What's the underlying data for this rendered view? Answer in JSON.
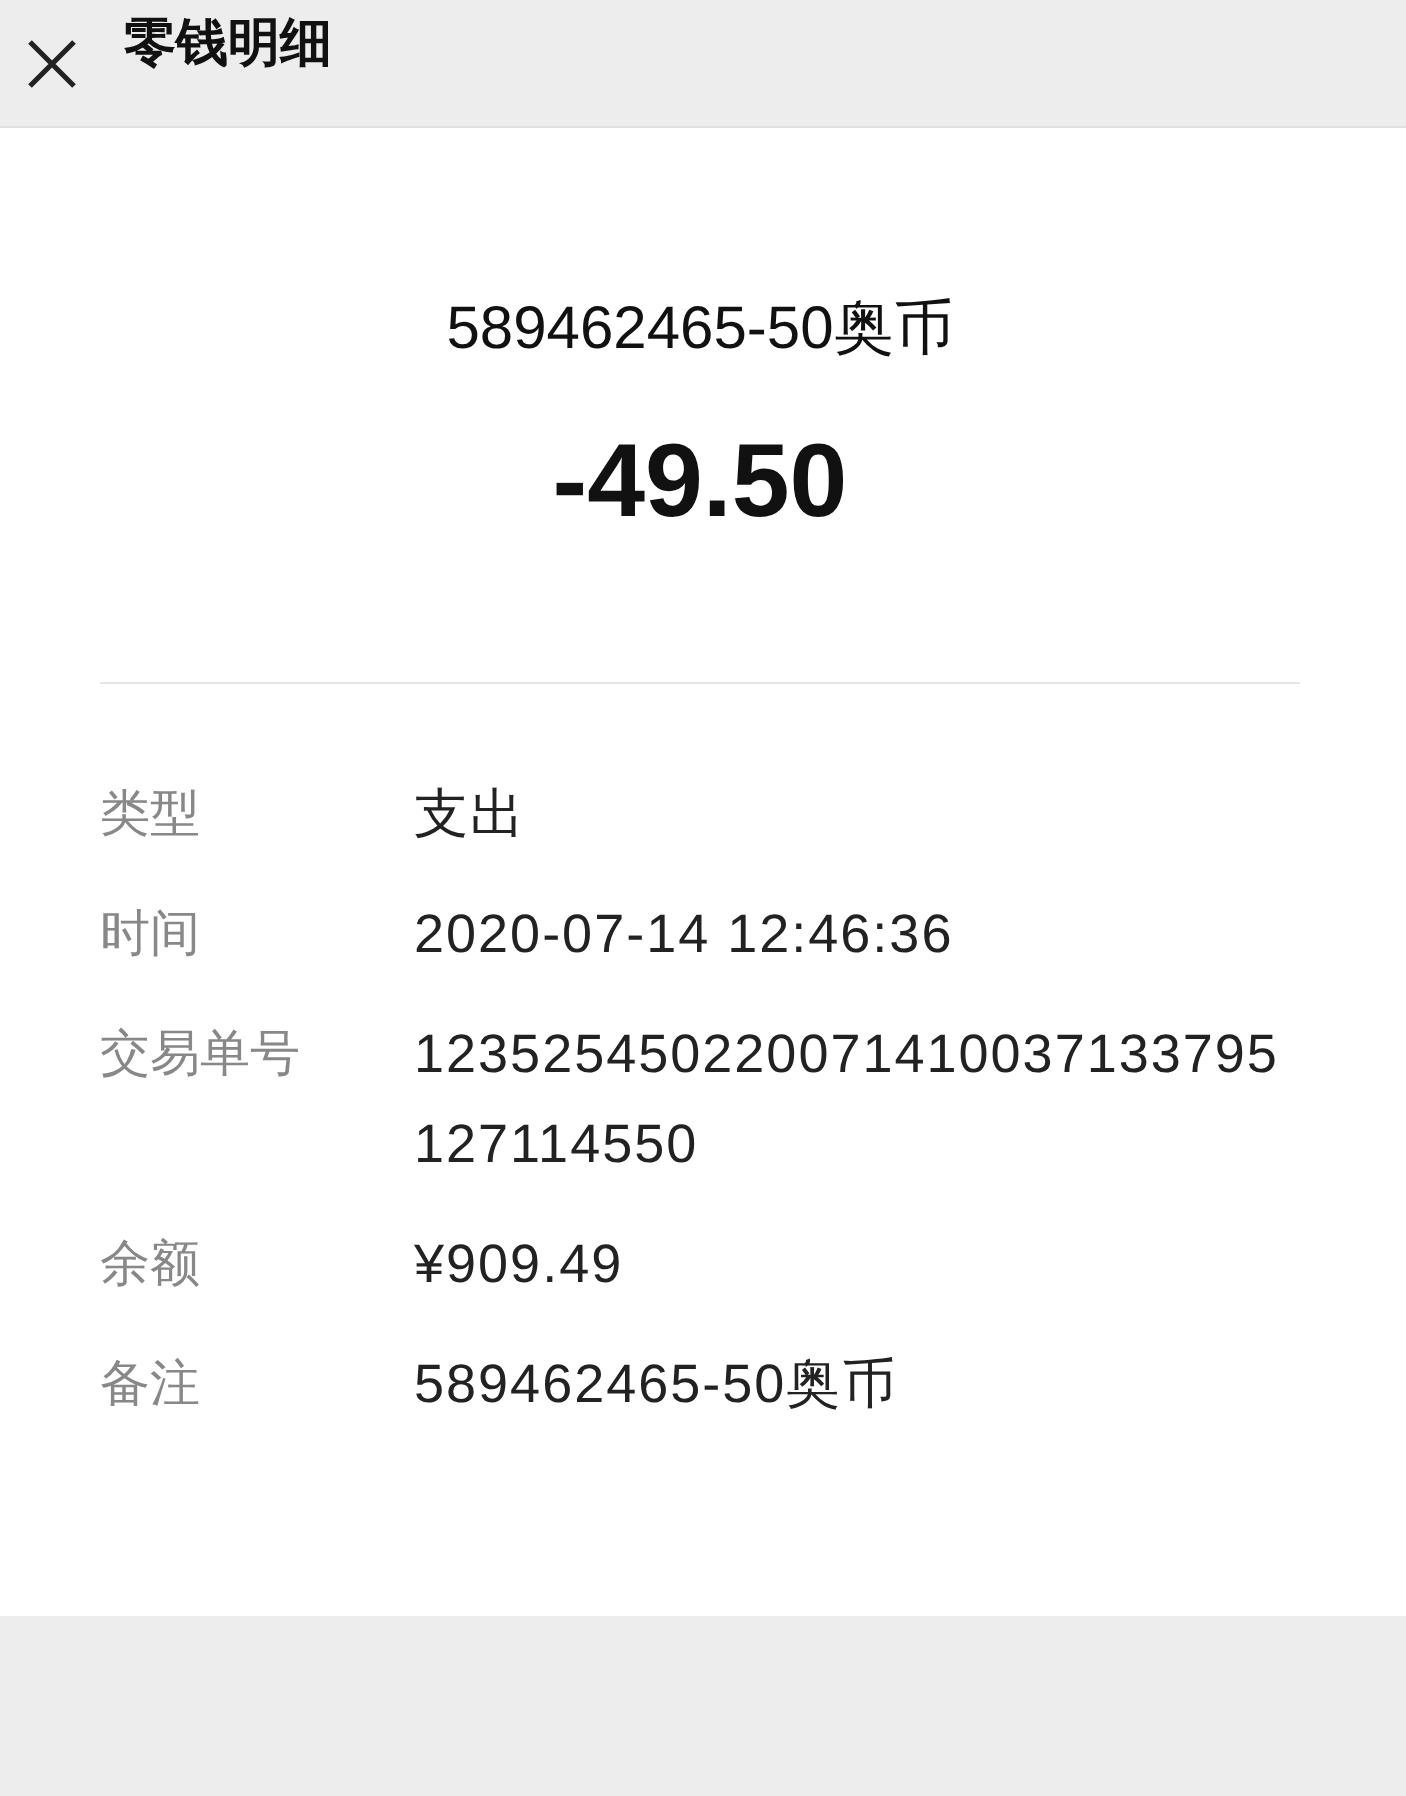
{
  "header": {
    "title": "零钱明细"
  },
  "summary": {
    "description": "589462465-50奥币",
    "amount": "-49.50"
  },
  "details": [
    {
      "label": "类型",
      "value": "支出"
    },
    {
      "label": "时间",
      "value": "2020-07-14 12:46:36"
    },
    {
      "label": "交易单号",
      "value": "123525450220071410037133795127114550"
    },
    {
      "label": "余额",
      "value": "¥909.49"
    },
    {
      "label": "备注",
      "value": "589462465-50奥币"
    }
  ]
}
